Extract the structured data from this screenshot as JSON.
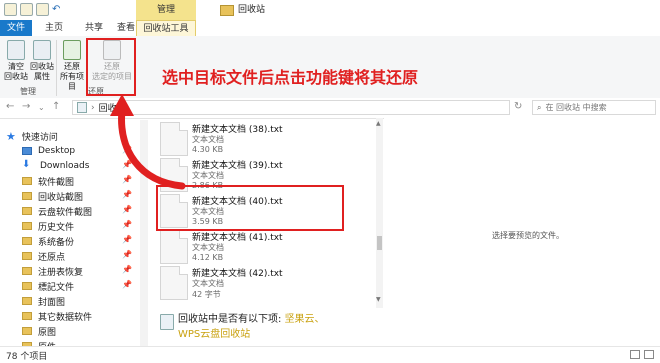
{
  "window": {
    "title": "回收站",
    "context_group": "管理"
  },
  "tabs": [
    "文件",
    "主页",
    "共享",
    "查看",
    "回收站工具"
  ],
  "ribbon": {
    "buttons": [
      {
        "label": "清空\n回收站"
      },
      {
        "label": "回收站\n属性"
      },
      {
        "label": "还原\n所有项目"
      },
      {
        "label": "还原\n选定的项目"
      }
    ],
    "groups": [
      "管理",
      "还原"
    ]
  },
  "annotation": "选中目标文件后点击功能键将其还原",
  "breadcrumb": "回收站",
  "search": {
    "placeholder": "在 回收站 中搜索"
  },
  "sidebar": {
    "items": [
      {
        "label": "快速访问",
        "type": "top"
      },
      {
        "label": "Desktop",
        "type": "blue",
        "pinned": true
      },
      {
        "label": "Downloads",
        "type": "down",
        "pinned": true
      },
      {
        "label": "软件截图",
        "pinned": true
      },
      {
        "label": "回收站截图",
        "pinned": true
      },
      {
        "label": "云盘软件截图",
        "pinned": true
      },
      {
        "label": "历史文件",
        "pinned": true
      },
      {
        "label": "系统备份",
        "pinned": true
      },
      {
        "label": "还原点",
        "pinned": true
      },
      {
        "label": "注册表恢复",
        "pinned": true
      },
      {
        "label": "標記文件",
        "pinned": true
      },
      {
        "label": "封面图"
      },
      {
        "label": "其它数据软件"
      },
      {
        "label": "原图"
      },
      {
        "label": "原件"
      }
    ]
  },
  "files": [
    {
      "name": "新建文本文档 (38).txt",
      "type": "文本文档",
      "size": "4.30 KB"
    },
    {
      "name": "新建文本文档 (39).txt",
      "type": "文本文档",
      "size": "2.86 KB"
    },
    {
      "name": "新建文本文档 (40).txt",
      "type": "文本文档",
      "size": "3.59 KB"
    },
    {
      "name": "新建文本文档 (41).txt",
      "type": "文本文档",
      "size": "4.12 KB"
    },
    {
      "name": "新建文本文档 (42).txt",
      "type": "文本文档",
      "size": "42 字节"
    }
  ],
  "recycle_info": {
    "line1": "回收站中是否有以下项:",
    "link1": "坚果云、",
    "link2": "WPS云盘回收站"
  },
  "preview": {
    "text": "选择要预览的文件。"
  },
  "status": {
    "count": "78 个项目"
  },
  "colors": {
    "accent": "#1979ca",
    "annotation": "#e02020",
    "context": "#f4e38d"
  }
}
